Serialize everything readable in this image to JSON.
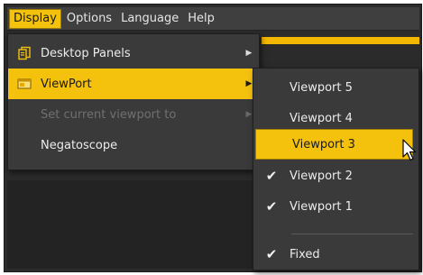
{
  "menubar": {
    "items": [
      {
        "label": "Display",
        "active": true
      },
      {
        "label": "Options",
        "active": false
      },
      {
        "label": "Language",
        "active": false
      },
      {
        "label": "Help",
        "active": false
      }
    ]
  },
  "display_menu": {
    "items": [
      {
        "label": "Desktop Panels",
        "icon": "desktop-panels-icon",
        "has_submenu": true,
        "state": "normal"
      },
      {
        "label": "ViewPort",
        "icon": "viewport-icon",
        "has_submenu": true,
        "state": "highlighted"
      },
      {
        "label": "Set current viewport to",
        "icon": "",
        "has_submenu": true,
        "state": "disabled"
      },
      {
        "label": "Negatoscope",
        "icon": "",
        "has_submenu": false,
        "state": "normal"
      }
    ]
  },
  "viewport_menu": {
    "items": [
      {
        "label": "Viewport 5",
        "checked": false,
        "state": "normal"
      },
      {
        "label": "Viewport 4",
        "checked": false,
        "state": "normal"
      },
      {
        "label": "Viewport 3",
        "checked": false,
        "state": "hovered"
      },
      {
        "label": "Viewport 2",
        "checked": true,
        "state": "normal"
      },
      {
        "label": "Viewport 1",
        "checked": true,
        "state": "normal"
      },
      {
        "label": "Fixed",
        "checked": true,
        "state": "normal"
      }
    ]
  },
  "theme": {
    "accent": "#f4c20d",
    "menu_background": "#3a3a3a",
    "menubar_background": "#3f3f3f",
    "text": "#ececec",
    "disabled_text": "#707070"
  }
}
